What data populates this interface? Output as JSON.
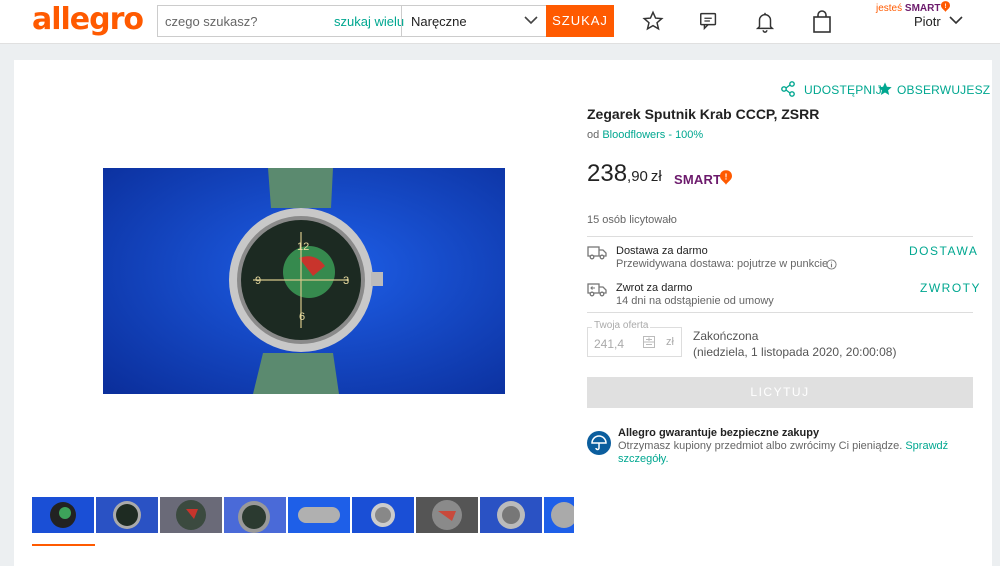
{
  "header": {
    "logo": "allegro",
    "search": {
      "placeholder": "czego szukasz?",
      "many_link": "szukaj wielu",
      "category": "Naręczne",
      "button": "SZUKAJ"
    },
    "smart_prefix": "jesteś ",
    "smart_word": "SMART",
    "user": "Piotr",
    "icons": [
      "star-icon",
      "chat-icon",
      "bell-icon",
      "bag-icon"
    ]
  },
  "product": {
    "share": "UDOSTĘPNIJ",
    "watching": "OBSERWUJESZ",
    "title": "Zegarek Sputnik Krab CCCP, ZSRR",
    "seller_prefix": "od",
    "seller": "Bloodflowers - 100%",
    "price_int": "238",
    "price_dec": ",90",
    "currency": "zł",
    "smart_label": "SMART",
    "bidders": "15 osób licytowało",
    "delivery": {
      "title": "Dostawa za darmo",
      "subtitle": "Przewidywana dostawa: pojutrze w punkcie",
      "link": "DOSTAWA"
    },
    "returns": {
      "title": "Zwrot za darmo",
      "subtitle": "14 dni na odstąpienie od umowy",
      "link": "ZWROTY"
    },
    "offer": {
      "label": "Twoja oferta",
      "value": "241,4",
      "currency": "zł"
    },
    "status": "Zakończona",
    "end_date": "(niedziela, 1 listopada 2020, 20:00:08)",
    "bid_button": "LICYTUJ",
    "guarantee": {
      "title": "Allegro gwarantuje bezpieczne zakupy",
      "text": "Otrzymasz kupiony przedmiot albo zwrócimy Ci pieniądze.",
      "link": "Sprawdź szczegóły."
    }
  },
  "colors": {
    "brand": "#ff5a00",
    "accent": "#00a790",
    "smart": "#6c1a6c"
  }
}
